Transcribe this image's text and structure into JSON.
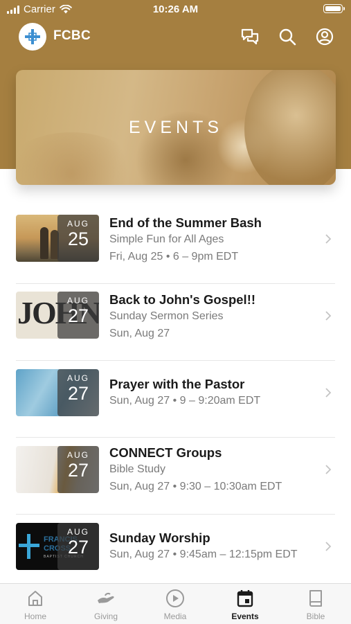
{
  "status_bar": {
    "carrier": "Carrier",
    "time": "10:26 AM"
  },
  "app": {
    "title": "FCBC"
  },
  "hero": {
    "title": "EVENTS"
  },
  "events": [
    {
      "title": "End of the Summer Bash",
      "subtitle": "Simple Fun for All Ages",
      "when": "Fri, Aug 25 • 6 – 9pm EDT",
      "month": "AUG",
      "day": "25"
    },
    {
      "title": "Back to John's Gospel!!",
      "subtitle": "Sunday Sermon Series",
      "when": "Sun, Aug 27",
      "month": "AUG",
      "day": "27",
      "thumb_text": "JOHN"
    },
    {
      "title": "Prayer with the Pastor",
      "subtitle": "",
      "when": "Sun, Aug 27 • 9 – 9:20am EDT",
      "month": "AUG",
      "day": "27"
    },
    {
      "title": "CONNECT Groups",
      "subtitle": "Bible Study",
      "when": "Sun, Aug 27 • 9:30 – 10:30am EDT",
      "month": "AUG",
      "day": "27"
    },
    {
      "title": "Sunday Worship",
      "subtitle": "",
      "when": "Sun, Aug 27 • 9:45am – 12:15pm EDT",
      "month": "AUG",
      "day": "27",
      "thumb_text": "FRANCIS CROSS",
      "thumb_subtext": "BAPTIST CHURCH"
    }
  ],
  "tabs": [
    {
      "label": "Home",
      "icon": "home-icon"
    },
    {
      "label": "Giving",
      "icon": "giving-icon"
    },
    {
      "label": "Media",
      "icon": "media-icon"
    },
    {
      "label": "Events",
      "icon": "calendar-icon",
      "active": true
    },
    {
      "label": "Bible",
      "icon": "bible-icon"
    }
  ],
  "colors": {
    "brand": "#a57f40",
    "logo_cross": "#3d8fd1",
    "text_primary": "#1a1a1a",
    "text_secondary": "#7a7a7a",
    "tab_inactive": "#9a9a9a"
  }
}
